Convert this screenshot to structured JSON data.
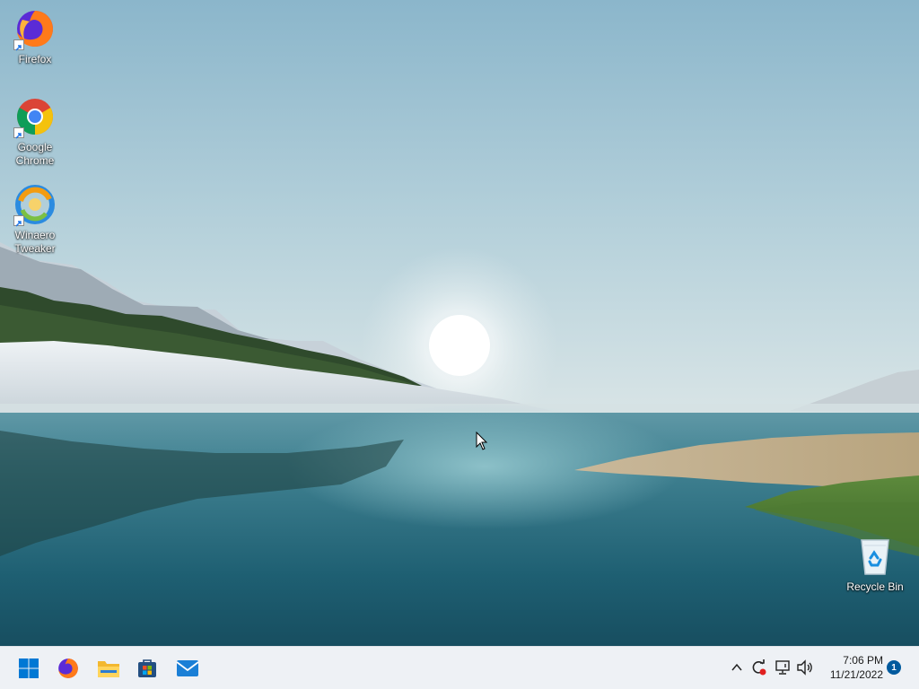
{
  "desktop": {
    "icons": [
      {
        "name": "firefox",
        "label": "Firefox"
      },
      {
        "name": "google-chrome",
        "label": "Google Chrome"
      },
      {
        "name": "winaero-tweaker",
        "label": "Winaero Tweaker"
      },
      {
        "name": "recycle-bin",
        "label": "Recycle Bin"
      }
    ]
  },
  "taskbar": {
    "pinned": [
      {
        "name": "start",
        "icon": "windows-logo-icon"
      },
      {
        "name": "firefox",
        "icon": "firefox-icon"
      },
      {
        "name": "file-explorer",
        "icon": "folder-icon"
      },
      {
        "name": "microsoft-store",
        "icon": "store-icon"
      },
      {
        "name": "mail",
        "icon": "mail-icon"
      }
    ],
    "tray": {
      "icons": [
        "chevron-up-icon",
        "sync-icon",
        "network-icon",
        "volume-icon"
      ],
      "time": "7:06 PM",
      "date": "11/21/2022",
      "notification_count": "1"
    }
  },
  "colors": {
    "taskbar_bg": "#eef1f5",
    "start_blue": "#0078d4",
    "badge_blue": "#005a9e"
  }
}
